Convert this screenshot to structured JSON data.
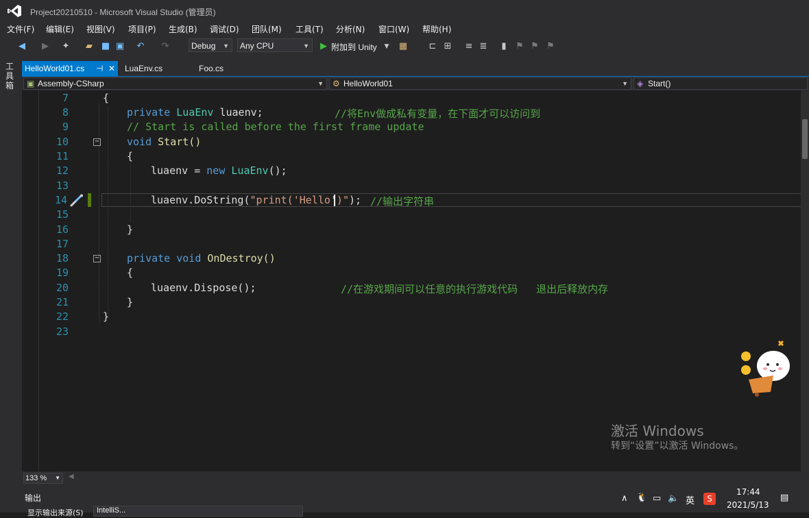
{
  "window": {
    "title": "Project20210510 - Microsoft Visual Studio (管理员)"
  },
  "menu": [
    "文件(F)",
    "编辑(E)",
    "视图(V)",
    "项目(P)",
    "生成(B)",
    "调试(D)",
    "团队(M)",
    "工具(T)",
    "分析(N)",
    "窗口(W)",
    "帮助(H)"
  ],
  "toolbar": {
    "config": "Debug",
    "platform": "Any CPU",
    "attach_label": "附加到 Unity"
  },
  "toolbox": {
    "label": "工具箱"
  },
  "tabs": [
    {
      "label": "HelloWorld01.cs",
      "pin": "⊣",
      "close": "✕"
    },
    {
      "label": "LuaEnv.cs"
    },
    {
      "label": "Foo.cs"
    }
  ],
  "navbar": {
    "project": "Assembly-CSharp",
    "class": "HelloWorld01",
    "member": "Start()"
  },
  "editor": {
    "lines": [
      {
        "num": "7"
      },
      {
        "num": "8"
      },
      {
        "num": "9"
      },
      {
        "num": "10"
      },
      {
        "num": "11"
      },
      {
        "num": "12"
      },
      {
        "num": "13"
      },
      {
        "num": "14"
      },
      {
        "num": "15"
      },
      {
        "num": "16"
      },
      {
        "num": "17"
      },
      {
        "num": "18"
      },
      {
        "num": "19"
      },
      {
        "num": "20"
      },
      {
        "num": "21"
      },
      {
        "num": "22"
      },
      {
        "num": "23"
      }
    ],
    "code": {
      "l7_brace": "{",
      "l8_kw": "private",
      "l8_type": "LuaEnv",
      "l8_rest": " luaenv;",
      "l8_comment": "//将Env做成私有变量，在下面才可以访问到",
      "l9_comment": "// Start is called before the first frame update",
      "l10_kw": "void",
      "l10_rest": " Start()",
      "l11_brace": "{",
      "l12_a": "luaenv = ",
      "l12_kw": "new",
      "l12_type": " LuaEnv",
      "l12_rest": "();",
      "l14_a": "luaenv.DoString(",
      "l14_str": "\"print('Hello')\"",
      "l14_rest": ");",
      "l14_comment": "//输出字符串",
      "l16_brace": "}",
      "l18_kw": "private void",
      "l18_rest": " OnDestroy()",
      "l19_brace": "{",
      "l20_a": "luaenv.Dispose();",
      "l20_comment": "//在游戏期间可以任意的执行游戏代码   退出后释放内存",
      "l21_brace": "}",
      "l22_brace": "}"
    }
  },
  "zoom": "133 %",
  "output": {
    "title": "输出",
    "source_label": "显示输出来源(S)",
    "source_value": "IntelliS..."
  },
  "tray": {
    "ime": "英",
    "time": "17:44",
    "date": "2021/5/13"
  },
  "watermark": {
    "title": "激活 Windows",
    "subtitle": "转到“设置”以激活 Windows。"
  },
  "colors": {
    "accent": "#007acc",
    "keyword": "#569cd6",
    "type": "#4ec9b0",
    "comment": "#57a64a",
    "string": "#d69d85",
    "line_number": "#2b91af"
  }
}
